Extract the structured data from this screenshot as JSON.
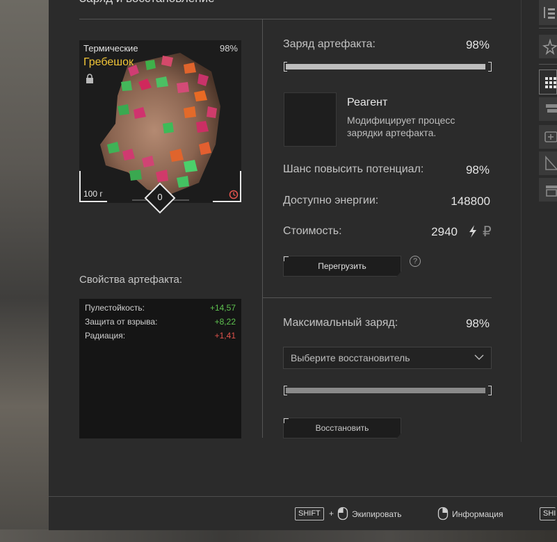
{
  "panel": {
    "title": "Заряд и восстановление"
  },
  "artifact": {
    "type": "Термические",
    "name": "Гребешок",
    "charge": "98%",
    "weight": "100 г",
    "level": "0"
  },
  "properties": {
    "title": "Свойства артефакта:",
    "rows": [
      {
        "name": "Пулестойкость:",
        "value": "+14,57",
        "color": "#5ec24f"
      },
      {
        "name": "Защита от взрыва:",
        "value": "+8,22",
        "color": "#5ec24f"
      },
      {
        "name": "Радиация:",
        "value": "+1,41",
        "color": "#e0524c"
      }
    ]
  },
  "charge": {
    "label": "Заряд артефакта:",
    "value": "98%",
    "progress": 0.98
  },
  "reagent": {
    "title": "Реагент",
    "desc": "Модифицирует процесс зарядки артефакта."
  },
  "stats": {
    "chance_label": "Шанс повысить потенциал:",
    "chance_value": "98%",
    "energy_label": "Доступно энергии:",
    "energy_value": "148800",
    "cost_label": "Стоимость:",
    "cost_value": "2940",
    "currency_icon": "ruble-icon",
    "energy_icon": "lightning-icon"
  },
  "overload": {
    "button": "Перегрузить",
    "help": "?"
  },
  "restore": {
    "max_label": "Максимальный заряд:",
    "max_value": "98%",
    "select_placeholder": "Выберите восстановитель",
    "progress": 0.98,
    "button": "Восстановить"
  },
  "hints": {
    "shift": "SHIFT",
    "plus": "+",
    "equip": "Экипировать",
    "info": "Информация",
    "shift2": "SHI"
  },
  "colors": {
    "accent": "#f0c437",
    "positive": "#5ec24f",
    "negative": "#e0524c"
  }
}
